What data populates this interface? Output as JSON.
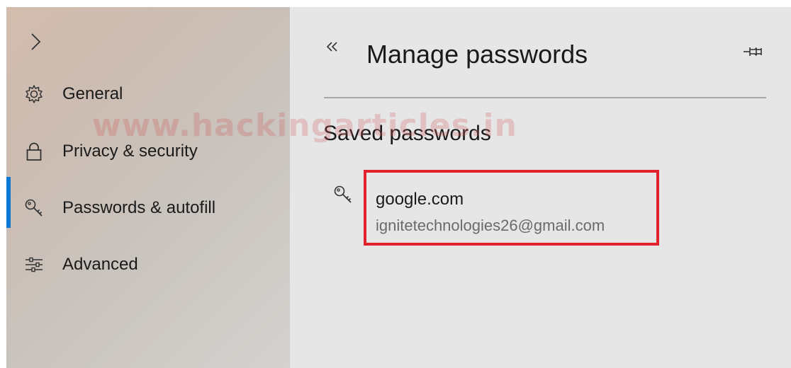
{
  "sidebar": {
    "items": [
      {
        "id": "general",
        "label": "General",
        "icon": "gear-icon"
      },
      {
        "id": "privacy",
        "label": "Privacy & security",
        "icon": "lock-icon"
      },
      {
        "id": "passwords",
        "label": "Passwords & autofill",
        "icon": "key-icon",
        "active": true
      },
      {
        "id": "advanced",
        "label": "Advanced",
        "icon": "sliders-icon"
      }
    ]
  },
  "watermark": "www.hackingarticles.in",
  "main": {
    "title": "Manage passwords",
    "section_title": "Saved passwords",
    "entries": [
      {
        "site": "google.com",
        "username": "ignitetechnologies26@gmail.com"
      }
    ]
  },
  "colors": {
    "accent": "#0a78d4",
    "highlight": "#e1222c",
    "panel_bg": "#e6e6e6"
  }
}
